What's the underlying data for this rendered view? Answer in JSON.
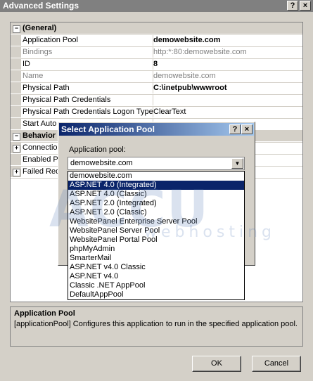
{
  "window": {
    "title": "Advanced Settings",
    "help_icon": "?",
    "close_icon": "×"
  },
  "grid": {
    "category_general": "(General)",
    "rows_general": [
      {
        "name": "Application Pool",
        "value": "demowebsite.com"
      },
      {
        "name": "Bindings",
        "value": "http:*:80:demowebsite.com"
      },
      {
        "name": "ID",
        "value": "8"
      },
      {
        "name": "Name",
        "value": "demowebsite.com"
      },
      {
        "name": "Physical Path",
        "value": "C:\\inetpub\\wwwroot"
      },
      {
        "name": "Physical Path Credentials",
        "value": ""
      },
      {
        "name": "Physical Path Credentials Logon Type",
        "value": "ClearText"
      },
      {
        "name": "Start Auto",
        "value": ""
      }
    ],
    "category_behavior": "Behavior",
    "rows_behavior": [
      {
        "name": "Connection",
        "expandable": true
      },
      {
        "name": "Enabled Pr",
        "expandable": false
      },
      {
        "name": "Failed Req",
        "expandable": true
      }
    ],
    "expander_minus": "−",
    "expander_plus": "+"
  },
  "description": {
    "title": "Application Pool",
    "text": "[applicationPool] Configures this application to run in the specified application pool."
  },
  "buttons": {
    "ok": "OK",
    "cancel": "Cancel"
  },
  "dialog": {
    "title": "Select Application Pool",
    "help_icon": "?",
    "close_icon": "×",
    "label": "Application pool:",
    "selected_value": "demowebsite.com",
    "dropdown_icon": "▼",
    "options": [
      "demowebsite.com",
      "ASP.NET 4.0 (Integrated)",
      "ASP.NET 4.0 (Classic)",
      "ASP.NET 2.0 (Integrated)",
      "ASP.NET 2.0 (Classic)",
      "WebsitePanel Enterprise Server Pool",
      "WebsitePanel Server Pool",
      "WebsitePanel Portal Pool",
      "phpMyAdmin",
      "SmarterMail",
      "ASP.NET v4.0 Classic",
      "ASP.NET v4.0",
      "Classic .NET AppPool",
      "DefaultAppPool"
    ],
    "highlighted_index": 1
  },
  "watermark": {
    "main": "ACCU",
    "sub": "webhosting"
  }
}
